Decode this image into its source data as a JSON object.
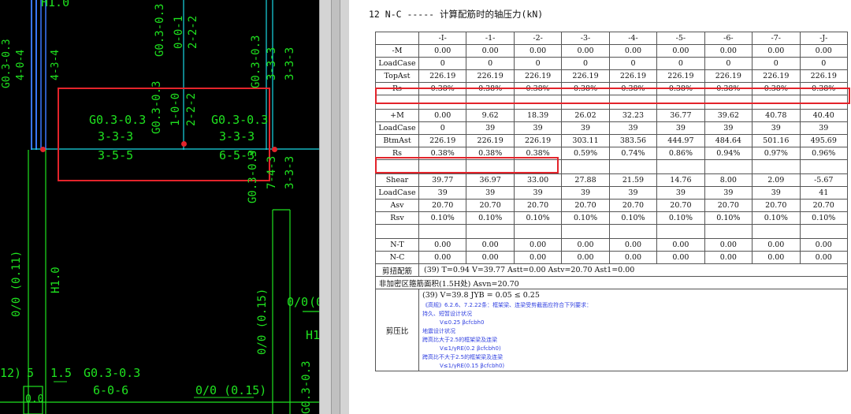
{
  "cad": {
    "top_labels": [
      "H1.0",
      "G0.3-0.3",
      "0-0-1",
      "2-2-2"
    ],
    "left_col": [
      "G0.3-0.3",
      "4-0-4"
    ],
    "left_col2": "4-3-4",
    "right_col": [
      "G0.3-0.3",
      "3-3-3",
      "3-3-3"
    ],
    "mid_center": [
      "G0.3-0.3",
      "1-0-0",
      "2-2-2"
    ],
    "mid_left": [
      "G0.3-0.3",
      "3-3-3",
      "3-5-5"
    ],
    "mid_right": [
      "G0.3-0.3",
      "3-3-3",
      "6-5-3"
    ],
    "right_lower": [
      "G0.3-0.3",
      "7-4-3",
      "3-3-3"
    ],
    "lower_left": [
      "0/0 (0.11)",
      "H1.0"
    ],
    "lower_mid": "0/0 (0.15)",
    "lower_right": [
      "0/0",
      "(0"
    ],
    "lower_right2": "H1",
    "bottom": {
      "a": "12)",
      "b": "5",
      "c": "1.5",
      "d": [
        "G0.3-0.3",
        "6-0-6"
      ],
      "e": "0/0 (0.15)",
      "f": "G0.3-0.3",
      "g": "0.0"
    }
  },
  "doc": {
    "title": "12 N-C ----- 计算配筋时的轴压力(kN)",
    "headers": [
      "",
      "-I-",
      "-1-",
      "-2-",
      "-3-",
      "-4-",
      "-5-",
      "-6-",
      "-7-",
      "-J-"
    ],
    "block1": [
      {
        "label": "-M",
        "values": [
          "0.00",
          "0.00",
          "0.00",
          "0.00",
          "0.00",
          "0.00",
          "0.00",
          "0.00",
          "0.00"
        ]
      },
      {
        "label": "LoadCase",
        "values": [
          "0",
          "0",
          "0",
          "0",
          "0",
          "0",
          "0",
          "0",
          "0"
        ]
      },
      {
        "label": "TopAst",
        "values": [
          "226.19",
          "226.19",
          "226.19",
          "226.19",
          "226.19",
          "226.19",
          "226.19",
          "226.19",
          "226.19"
        ]
      },
      {
        "label": "Rs",
        "values": [
          "0.38%",
          "0.38%",
          "0.38%",
          "0.38%",
          "0.38%",
          "0.38%",
          "0.38%",
          "0.38%",
          "0.38%"
        ]
      }
    ],
    "block2": [
      {
        "label": "+M",
        "values": [
          "0.00",
          "9.62",
          "18.39",
          "26.02",
          "32.23",
          "36.77",
          "39.62",
          "40.78",
          "40.40"
        ]
      },
      {
        "label": "LoadCase",
        "values": [
          "0",
          "39",
          "39",
          "39",
          "39",
          "39",
          "39",
          "39",
          "39"
        ]
      },
      {
        "label": "BtmAst",
        "values": [
          "226.19",
          "226.19",
          "226.19",
          "303.11",
          "383.56",
          "444.97",
          "484.64",
          "501.16",
          "495.69"
        ]
      },
      {
        "label": "Rs",
        "values": [
          "0.38%",
          "0.38%",
          "0.38%",
          "0.59%",
          "0.74%",
          "0.86%",
          "0.94%",
          "0.97%",
          "0.96%"
        ]
      }
    ],
    "block3": [
      {
        "label": "Shear",
        "values": [
          "39.77",
          "36.97",
          "33.00",
          "27.88",
          "21.59",
          "14.76",
          "8.00",
          "2.09",
          "-5.67"
        ]
      },
      {
        "label": "LoadCase",
        "values": [
          "39",
          "39",
          "39",
          "39",
          "39",
          "39",
          "39",
          "39",
          "41"
        ]
      },
      {
        "label": "Asv",
        "values": [
          "20.70",
          "20.70",
          "20.70",
          "20.70",
          "20.70",
          "20.70",
          "20.70",
          "20.70",
          "20.70"
        ]
      },
      {
        "label": "Rsv",
        "values": [
          "0.10%",
          "0.10%",
          "0.10%",
          "0.10%",
          "0.10%",
          "0.10%",
          "0.10%",
          "0.10%",
          "0.10%"
        ]
      }
    ],
    "block4": [
      {
        "label": "N-T",
        "values": [
          "0.00",
          "0.00",
          "0.00",
          "0.00",
          "0.00",
          "0.00",
          "0.00",
          "0.00",
          "0.00"
        ]
      },
      {
        "label": "N-C",
        "values": [
          "0.00",
          "0.00",
          "0.00",
          "0.00",
          "0.00",
          "0.00",
          "0.00",
          "0.00",
          "0.00"
        ]
      }
    ],
    "torsion_label": "剪扭配筋",
    "torsion_text": "(39)  T=0.94  V=39.77  Astt=0.00  Astv=20.70  Ast1=0.00",
    "stirrup_text": "非加密区箍筋面积(1.5H处)  Asvn=20.70",
    "shear_ratio_label": "剪压比",
    "shear_ratio_line": "(39)  V=39.8  JYB = 0.05 ≤ 0.25",
    "code_lines": [
      "《高规》6.2.6、7.2.22条：框架梁、连梁受剪截面应符合下列要求：",
      "持久、短暂设计状况",
      "V≤0.25 βcfcbh0",
      "地震设计状况",
      "跨高比大于2.5的框架梁及连梁",
      "V≤1/γRE(0.2 βcfcbh0)",
      "跨高比不大于2.5的框架梁及连梁",
      "V≤1/γRE(0.15 βcfcbh0)"
    ]
  },
  "colors": {
    "highlight": "#e3242b",
    "cad_green": "#1fe21f",
    "cad_cyan": "#19d9e6",
    "code_blue": "#2f3fe0"
  }
}
